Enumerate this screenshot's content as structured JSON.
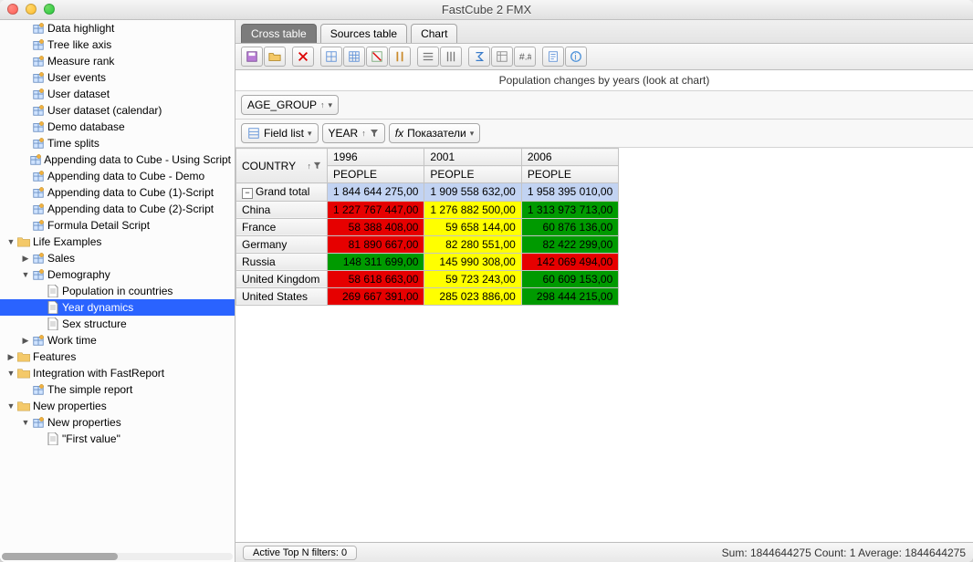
{
  "window": {
    "title": "FastCube 2 FMX"
  },
  "tree": [
    {
      "level": 1,
      "icon": "cube",
      "label": "Data highlight"
    },
    {
      "level": 1,
      "icon": "cube",
      "label": "Tree like axis"
    },
    {
      "level": 1,
      "icon": "cube",
      "label": "Measure rank"
    },
    {
      "level": 1,
      "icon": "cube",
      "label": "User events"
    },
    {
      "level": 1,
      "icon": "cube",
      "label": "User dataset"
    },
    {
      "level": 1,
      "icon": "cube",
      "label": "User dataset (calendar)"
    },
    {
      "level": 1,
      "icon": "cube",
      "label": "Demo database"
    },
    {
      "level": 1,
      "icon": "cube",
      "label": "Time splits"
    },
    {
      "level": 1,
      "icon": "cube",
      "label": "Appending data to Cube - Using Script"
    },
    {
      "level": 1,
      "icon": "cube",
      "label": "Appending data to Cube - Demo"
    },
    {
      "level": 1,
      "icon": "cube",
      "label": "Appending data to Cube (1)-Script"
    },
    {
      "level": 1,
      "icon": "cube",
      "label": "Appending data to Cube (2)-Script"
    },
    {
      "level": 1,
      "icon": "cube",
      "label": "Formula Detail Script"
    },
    {
      "level": 0,
      "icon": "folder",
      "label": "Life Examples",
      "disclosure": "open"
    },
    {
      "level": 1,
      "icon": "cube",
      "label": "Sales",
      "disclosure": "closed"
    },
    {
      "level": 1,
      "icon": "cube",
      "label": "Demography",
      "disclosure": "open"
    },
    {
      "level": 2,
      "icon": "doc",
      "label": "Population in countries"
    },
    {
      "level": 2,
      "icon": "doc",
      "label": "Year dynamics",
      "selected": true
    },
    {
      "level": 2,
      "icon": "doc",
      "label": "Sex structure"
    },
    {
      "level": 1,
      "icon": "cube",
      "label": "Work time",
      "disclosure": "closed"
    },
    {
      "level": 0,
      "icon": "folder",
      "label": "Features",
      "disclosure": "closed"
    },
    {
      "level": 0,
      "icon": "folder",
      "label": "Integration with FastReport",
      "disclosure": "open"
    },
    {
      "level": 1,
      "icon": "cube",
      "label": "The simple report"
    },
    {
      "level": 0,
      "icon": "folder",
      "label": "New properties",
      "disclosure": "open"
    },
    {
      "level": 1,
      "icon": "cube",
      "label": "New properties",
      "disclosure": "open"
    },
    {
      "level": 2,
      "icon": "doc",
      "label": "\"First value\""
    }
  ],
  "tabs": [
    {
      "label": "Cross table",
      "active": true
    },
    {
      "label": "Sources table",
      "active": false
    },
    {
      "label": "Chart",
      "active": false
    }
  ],
  "subtitle": "Population changes by years (look at chart)",
  "dimbar": {
    "field": "AGE_GROUP"
  },
  "fieldbar": {
    "fieldlist": "Field list",
    "year": "YEAR",
    "measures": "Показатели"
  },
  "grid": {
    "country_hdr": "COUNTRY",
    "years": [
      "1996",
      "2001",
      "2006"
    ],
    "people": "PEOPLE",
    "grandtotal": "Grand total",
    "gt_values": [
      "1 844 644 275,00",
      "1 909 558 632,00",
      "1 958 395 010,00"
    ],
    "rows": [
      {
        "country": "China",
        "cells": [
          {
            "v": "1 227 767 447,00",
            "c": "red"
          },
          {
            "v": "1 276 882 500,00",
            "c": "yellow"
          },
          {
            "v": "1 313 973 713,00",
            "c": "green"
          }
        ]
      },
      {
        "country": "France",
        "cells": [
          {
            "v": "58 388 408,00",
            "c": "red"
          },
          {
            "v": "59 658 144,00",
            "c": "yellow"
          },
          {
            "v": "60 876 136,00",
            "c": "green"
          }
        ]
      },
      {
        "country": "Germany",
        "cells": [
          {
            "v": "81 890 667,00",
            "c": "red"
          },
          {
            "v": "82 280 551,00",
            "c": "yellow"
          },
          {
            "v": "82 422 299,00",
            "c": "green"
          }
        ]
      },
      {
        "country": "Russia",
        "cells": [
          {
            "v": "148 311 699,00",
            "c": "green"
          },
          {
            "v": "145 990 308,00",
            "c": "yellow"
          },
          {
            "v": "142 069 494,00",
            "c": "red"
          }
        ]
      },
      {
        "country": "United Kingdom",
        "cells": [
          {
            "v": "58 618 663,00",
            "c": "red"
          },
          {
            "v": "59 723 243,00",
            "c": "yellow"
          },
          {
            "v": "60 609 153,00",
            "c": "green"
          }
        ]
      },
      {
        "country": "United States",
        "cells": [
          {
            "v": "269 667 391,00",
            "c": "red"
          },
          {
            "v": "285 023 886,00",
            "c": "yellow"
          },
          {
            "v": "298 444 215,00",
            "c": "green"
          }
        ]
      }
    ]
  },
  "status": {
    "topn": "Active Top N filters: 0",
    "summary": "Sum: 1844644275  Count: 1  Average: 1844644275"
  }
}
